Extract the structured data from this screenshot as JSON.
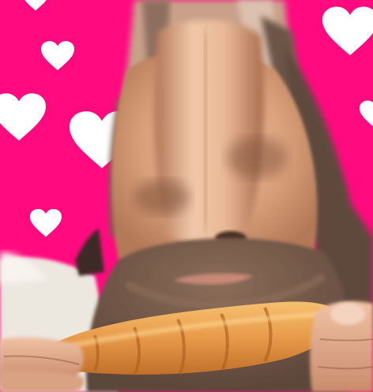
{
  "image": {
    "description_hidden": true,
    "colors": {
      "background": "#ff0a7f",
      "heart": "#ffffff",
      "skin_light": "#f0c7a8",
      "skin_mid": "#d49a76",
      "skin_dark": "#a8694a",
      "hair_beard": "#6f5646",
      "croissant_light": "#f2b15e",
      "croissant_dark": "#c9782f",
      "shirt": "#ece7df",
      "dark_hair_top": "#5a4638"
    }
  }
}
